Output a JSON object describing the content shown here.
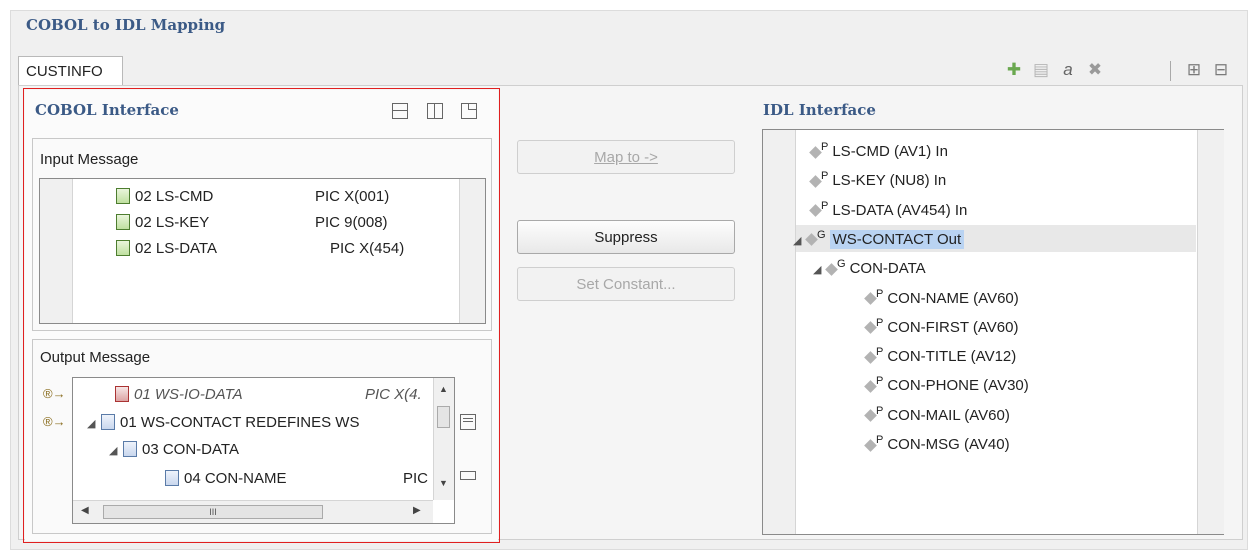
{
  "window": {
    "title": "COBOL to IDL Mapping"
  },
  "tab": {
    "label": "CUSTINFO"
  },
  "toolbar": {
    "icons": [
      "add-icon",
      "copy-icon",
      "rename-icon",
      "delete-icon",
      "expand-all-icon",
      "collapse-all-icon"
    ],
    "glyphs": {
      "add": "✚",
      "copy": "▤",
      "rename": "a",
      "delete": "✖",
      "expand": "⊞",
      "collapse": "⊟"
    }
  },
  "cobol": {
    "title": "COBOL Interface",
    "input": {
      "label": "Input Message",
      "rows": [
        {
          "name": "02 LS-CMD",
          "pic": "PIC  X(001)"
        },
        {
          "name": "02 LS-KEY",
          "pic": "PIC  9(008)"
        },
        {
          "name": "02 LS-DATA",
          "pic": "PIC  X(454)"
        }
      ]
    },
    "output": {
      "label": "Output Message",
      "rows": [
        {
          "name": "01 WS-IO-DATA",
          "pic": "PIC  X(4."
        },
        {
          "name": "01 WS-CONTACT REDEFINES WS",
          "pic": ""
        },
        {
          "name": "03 CON-DATA",
          "pic": ""
        },
        {
          "name": "04 CON-NAME",
          "pic": "PIC"
        }
      ],
      "hscroll_thumb": "III"
    }
  },
  "actions": {
    "map_to": "Map to ->",
    "suppress": "Suppress",
    "set_constant": "Set Constant..."
  },
  "idl": {
    "title": "IDL Interface",
    "rows": [
      {
        "text": "LS-CMD  (AV1)  In",
        "badge": "P",
        "indent": 0,
        "arrow": ""
      },
      {
        "text": "LS-KEY  (NU8)  In",
        "badge": "P",
        "indent": 0,
        "arrow": ""
      },
      {
        "text": "LS-DATA  (AV454)  In",
        "badge": "P",
        "indent": 0,
        "arrow": ""
      },
      {
        "text": "WS-CONTACT  Out",
        "badge": "G",
        "indent": 0,
        "arrow": "◢",
        "selected": true
      },
      {
        "text": "CON-DATA",
        "badge": "G",
        "indent": 1,
        "arrow": "◢"
      },
      {
        "text": "CON-NAME  (AV60)",
        "badge": "P",
        "indent": 2,
        "arrow": ""
      },
      {
        "text": "CON-FIRST  (AV60)",
        "badge": "P",
        "indent": 2,
        "arrow": ""
      },
      {
        "text": "CON-TITLE  (AV12)",
        "badge": "P",
        "indent": 2,
        "arrow": ""
      },
      {
        "text": "CON-PHONE  (AV30)",
        "badge": "P",
        "indent": 2,
        "arrow": ""
      },
      {
        "text": "CON-MAIL  (AV60)",
        "badge": "P",
        "indent": 2,
        "arrow": ""
      },
      {
        "text": "CON-MSG  (AV40)",
        "badge": "P",
        "indent": 2,
        "arrow": ""
      }
    ]
  },
  "colors": {
    "accent": "#3b5a86",
    "selection": "#b9d3f2",
    "red_box": "#e02020"
  }
}
